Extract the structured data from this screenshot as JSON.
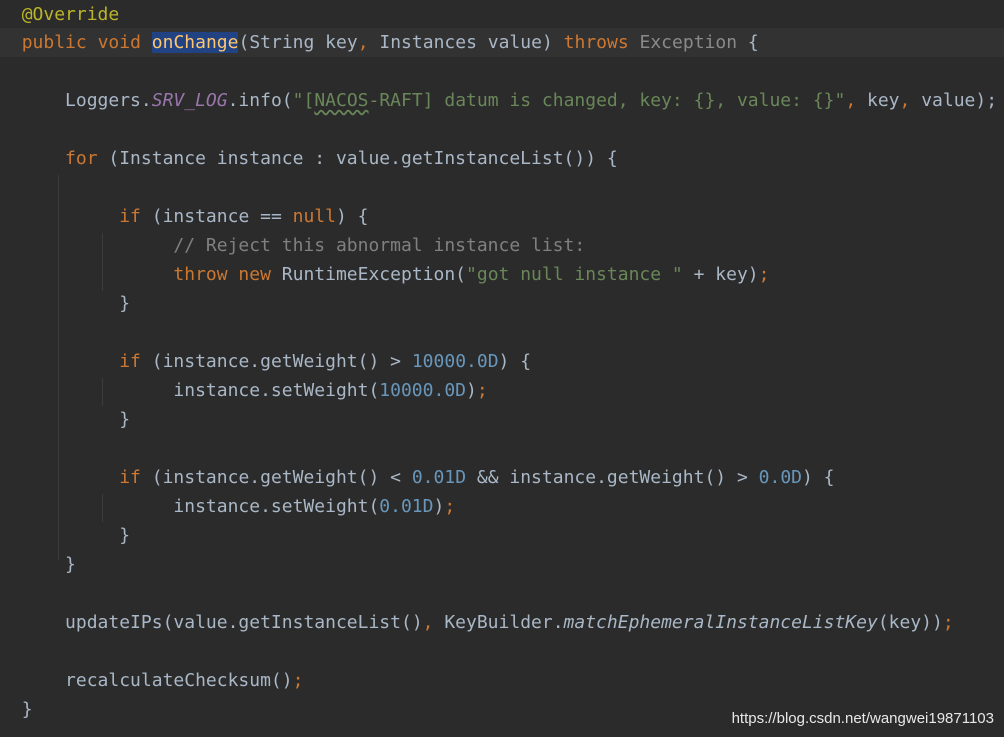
{
  "code": {
    "annotation": "@Override",
    "sig": {
      "public": "public",
      "void": "void",
      "method": "onChange",
      "open": "(",
      "type1": "String",
      "param1": " key",
      "comma": ",",
      "type2": " Instances",
      "param2": " value",
      "close": ") ",
      "throws": "throws",
      "exception": " Exception",
      "brace": " {"
    },
    "log": {
      "cls": "Loggers.",
      "field": "SRV_LOG",
      "call": ".info(",
      "str_a": "\"[",
      "str_b": "NACOS",
      "str_c": "-RAFT] datum is changed, key: {}, value: {}\"",
      "comma1": ",",
      "arg1": " key",
      "comma2": ",",
      "arg2": " value",
      "end": ");"
    },
    "for_line": {
      "kw": "for",
      "rest": " (Instance instance : value.getInstanceList()) {"
    },
    "if1": {
      "kw": "if",
      "open": " (instance == ",
      "null": "null",
      "close": ") {"
    },
    "comment": "// Reject this abnormal instance list:",
    "throw_line": {
      "throw": "throw",
      "new": " new",
      "cls": " RuntimeException(",
      "str": "\"got null instance \"",
      "rest": " + key)",
      "semi": ";"
    },
    "brace_close": "}",
    "if2": {
      "kw": "if",
      "open": " (instance.getWeight() > ",
      "num": "10000.0D",
      "close": ") {"
    },
    "set1": {
      "call": "instance.setWeight(",
      "num": "10000.0D",
      "close": ")",
      "semi": ";"
    },
    "if3": {
      "kw": "if",
      "open": " (instance.getWeight() < ",
      "num1": "0.01D",
      "mid": " && instance.getWeight() > ",
      "num2": "0.0D",
      "close": ") {"
    },
    "set2": {
      "call": "instance.setWeight(",
      "num": "0.01D",
      "close": ")",
      "semi": ";"
    },
    "update": {
      "call": "updateIPs(value.getInstanceList()",
      "comma": ",",
      "cls": " KeyBuilder.",
      "method": "matchEphemeralInstanceListKey",
      "close": "(key))",
      "semi": ";"
    },
    "recalc": {
      "call": "recalculateChecksum()",
      "semi": ";"
    }
  },
  "watermark": "https://blog.csdn.net/wangwei19871103",
  "colors": {
    "background": "#2b2b2b",
    "keyword": "#cc7832",
    "annotation": "#bbb529",
    "method": "#ffc66d",
    "string": "#6a8759",
    "number": "#6897bb",
    "comment": "#808080",
    "selection": "#214283"
  }
}
